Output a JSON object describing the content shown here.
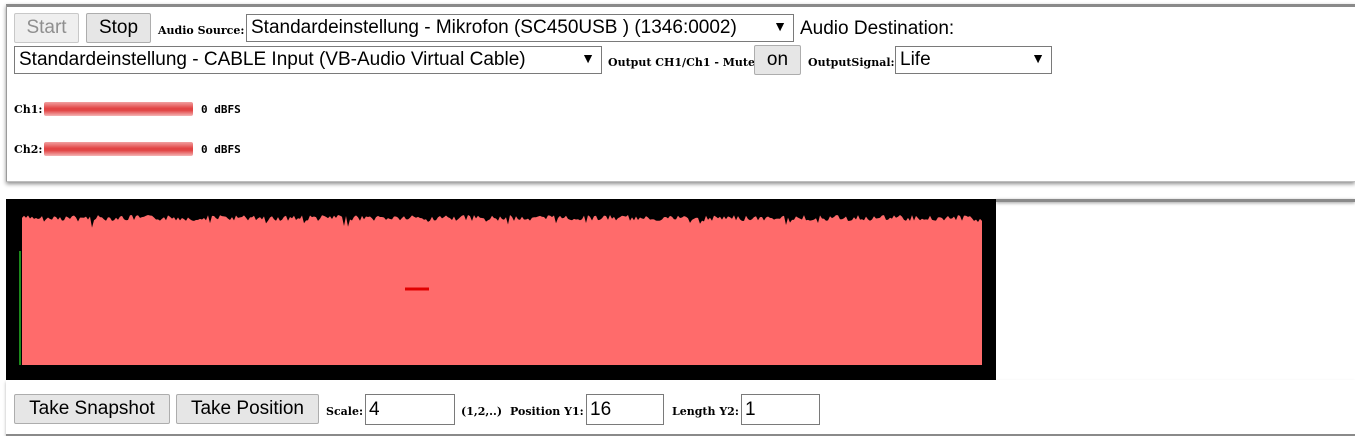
{
  "toolbar": {
    "start_label": "Start",
    "stop_label": "Stop",
    "audio_source_label": "Audio Source:",
    "audio_source_value": "Standardeinstellung - Mikrofon (SC450USB ) (1346:0002)",
    "audio_destination_label": "Audio Destination:",
    "audio_destination_value": "Standardeinstellung - CABLE Input (VB-Audio Virtual Cable)",
    "output_mute_label": "Output CH1/Ch1 - Mute",
    "mute_toggle_label": "on",
    "output_signal_label": "OutputSignal:",
    "output_signal_value": "Life"
  },
  "meters": [
    {
      "label": "Ch1:",
      "value": "0",
      "unit": "dBFS"
    },
    {
      "label": "Ch2:",
      "value": "0",
      "unit": "dBFS"
    }
  ],
  "scope": {
    "background": "#000000",
    "fill_color": "#ff6b6b",
    "marker_color": "#e00000",
    "left_trace_color": "#00a000"
  },
  "controls": {
    "snapshot_label": "Take Snapshot",
    "position_label": "Take Position",
    "scale_label": "Scale:",
    "scale_value": "4",
    "scale_hint": "(1,2,..)",
    "position_y1_label": "Position Y1:",
    "position_y1_value": "16",
    "length_y2_label": "Length Y2:",
    "length_y2_value": "1"
  }
}
